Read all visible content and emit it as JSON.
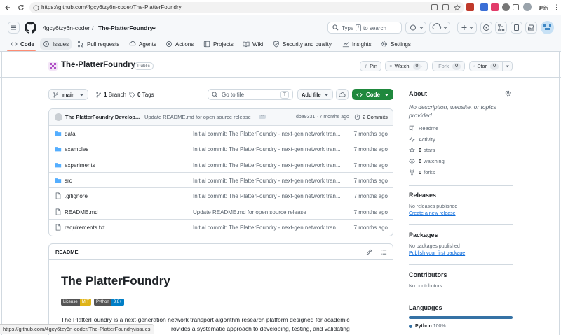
{
  "browser": {
    "url": "https://github.com/4gcy6tzy6n-coder/The-PlatterFoundry",
    "update_label": "更新",
    "status_url": "https://github.com/4gcy6tzy6n-coder/The-PlatterFoundry/issues"
  },
  "header": {
    "owner": "4gcy6tzy6n-coder",
    "separator": "/",
    "repo": "The-PlatterFoundry",
    "search_placeholder_prefix": "Type",
    "search_key": "/",
    "search_placeholder_suffix": "to search"
  },
  "tabs": [
    {
      "label": "Code",
      "icon": "code-icon"
    },
    {
      "label": "Issues",
      "icon": "issue-icon"
    },
    {
      "label": "Pull requests",
      "icon": "pull-request-icon"
    },
    {
      "label": "Agents",
      "icon": "agents-icon"
    },
    {
      "label": "Actions",
      "icon": "actions-icon"
    },
    {
      "label": "Projects",
      "icon": "projects-icon"
    },
    {
      "label": "Wiki",
      "icon": "wiki-icon"
    },
    {
      "label": "Security and quality",
      "icon": "shield-icon"
    },
    {
      "label": "Insights",
      "icon": "graph-icon"
    },
    {
      "label": "Settings",
      "icon": "gear-icon"
    }
  ],
  "repo": {
    "title": "The-PlatterFoundry",
    "visibility": "Public",
    "pin_label": "Pin",
    "watch_label": "Watch",
    "watch_count": "0",
    "fork_label": "Fork",
    "fork_count": "0",
    "star_label": "Star",
    "star_count": "0"
  },
  "toolbar": {
    "branch": "main",
    "branch_count": "1",
    "branch_label": "Branch",
    "tag_count": "0",
    "tag_label": "Tags",
    "goto_placeholder": "Go to file",
    "goto_key": "T",
    "add_file_label": "Add file",
    "code_label": "Code"
  },
  "commit": {
    "author": "The PlatterFoundry Develop...",
    "message": "Update README.md for open source release",
    "hash": "dba9331",
    "sep": "·",
    "time": "7 months ago",
    "count_label": "2 Commits"
  },
  "files": [
    {
      "name": "data",
      "type": "folder",
      "message": "Initial commit: The PlatterFoundry - next-gen network tran...",
      "time": "7 months ago"
    },
    {
      "name": "examples",
      "type": "folder",
      "message": "Initial commit: The PlatterFoundry - next-gen network tran...",
      "time": "7 months ago"
    },
    {
      "name": "experiments",
      "type": "folder",
      "message": "Initial commit: The PlatterFoundry - next-gen network tran...",
      "time": "7 months ago"
    },
    {
      "name": "src",
      "type": "folder",
      "message": "Initial commit: The PlatterFoundry - next-gen network tran...",
      "time": "7 months ago"
    },
    {
      "name": ".gitignore",
      "type": "file",
      "message": "Initial commit: The PlatterFoundry - next-gen network tran...",
      "time": "7 months ago"
    },
    {
      "name": "README.md",
      "type": "file",
      "message": "Update README.md for open source release",
      "time": "7 months ago"
    },
    {
      "name": "requirements.txt",
      "type": "file",
      "message": "Initial commit: The PlatterFoundry - next-gen network tran...",
      "time": "7 months ago"
    }
  ],
  "readme": {
    "tab_label": "README",
    "heading": "The PlatterFoundry",
    "badge1_left": "License",
    "badge1_right": "MIT",
    "badge2_left": "Python",
    "badge2_right": "3.8+",
    "paragraph_line1": "The PlatterFoundry is a next-generation network transport algorithm research platform designed for academic",
    "paragraph_line2": "rovides a systematic approach to developing, testing, and validating"
  },
  "about": {
    "heading": "About",
    "description": "No description, website, or topics provided.",
    "items": [
      {
        "icon": "book-icon",
        "label": "Readme"
      },
      {
        "icon": "pulse-icon",
        "label": "Activity"
      },
      {
        "icon": "star-icon",
        "count": "0",
        "label": "stars"
      },
      {
        "icon": "eye-icon",
        "count": "0",
        "label": "watching"
      },
      {
        "icon": "fork-icon",
        "count": "0",
        "label": "forks"
      }
    ]
  },
  "releases": {
    "heading": "Releases",
    "text": "No releases published",
    "link": "Create a new release"
  },
  "packages": {
    "heading": "Packages",
    "text": "No packages published",
    "link": "Publish your first package"
  },
  "contributors": {
    "heading": "Contributors",
    "text": "No contributors"
  },
  "languages": {
    "heading": "Languages",
    "name": "Python",
    "percent": "100%",
    "color": "#3572A5"
  },
  "colors": {
    "accent": "#0969da",
    "code_button": "#1f883d",
    "tab_underline": "#fd8c73"
  }
}
